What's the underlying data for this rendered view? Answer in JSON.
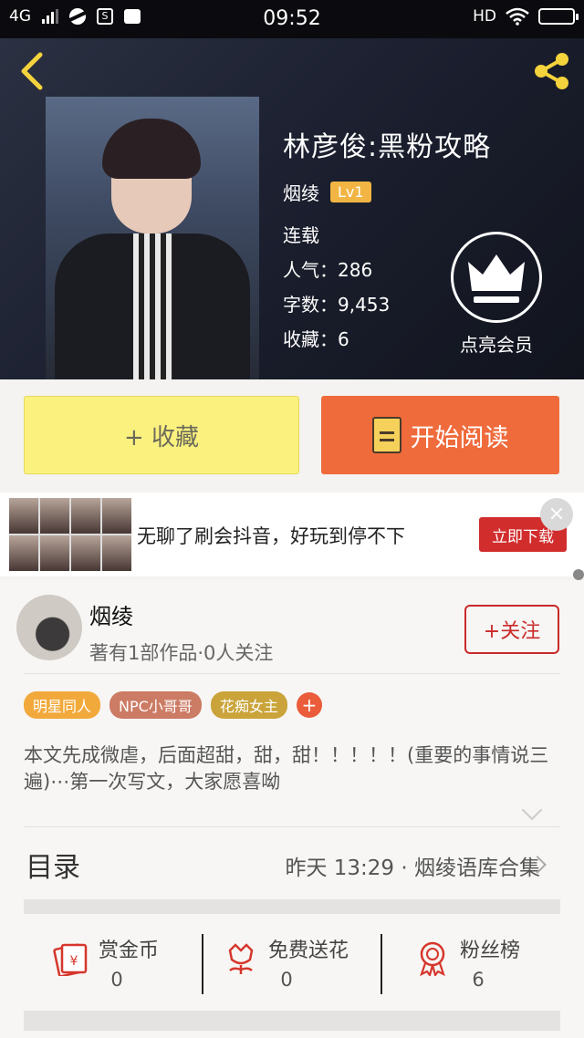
{
  "status_bar": {
    "network": "4G",
    "time": "09:52",
    "hd": "HD"
  },
  "header": {
    "title": "林彦俊:黑粉攻略",
    "author": "烟绫",
    "level": "Lv1",
    "status": "连载",
    "popularity": "人气：286",
    "word_count": "字数：9,453",
    "favorites": "收藏：6",
    "vip_label": "点亮会员"
  },
  "actions": {
    "favorite_label": "+ 收藏",
    "read_label": "开始阅读"
  },
  "ad": {
    "text": "无聊了刷会抖音，好玩到停不下",
    "button": "立即下载"
  },
  "author_card": {
    "name": "烟绫",
    "stats": "著有1部作品·0人关注",
    "follow_label": "+关注"
  },
  "tags": [
    {
      "label": "明星同人",
      "color": "#f2a93b"
    },
    {
      "label": "NPC小哥哥",
      "color": "#cc7b64"
    },
    {
      "label": "花痴女主",
      "color": "#caa43a"
    }
  ],
  "tag_more": "+",
  "description": "本文先成微虐，后面超甜，甜，甜！！！！！(重要的事情说三遍)⋯第一次写文，大家愿喜呦",
  "toc": {
    "label": "目录",
    "latest": "昨天 13:29 · 烟绫语库合集"
  },
  "stats": [
    {
      "label": "赏金币",
      "value": "0",
      "icon": "red-envelope-icon"
    },
    {
      "label": "免费送花",
      "value": "0",
      "icon": "flower-icon"
    },
    {
      "label": "粉丝榜",
      "value": "6",
      "icon": "medal-icon"
    }
  ],
  "colors": {
    "accent_orange": "#ef6b3c",
    "favorite_yellow": "#fbf17f",
    "follow_red": "#c92a2a",
    "icon_yellow": "#f4d33c"
  }
}
